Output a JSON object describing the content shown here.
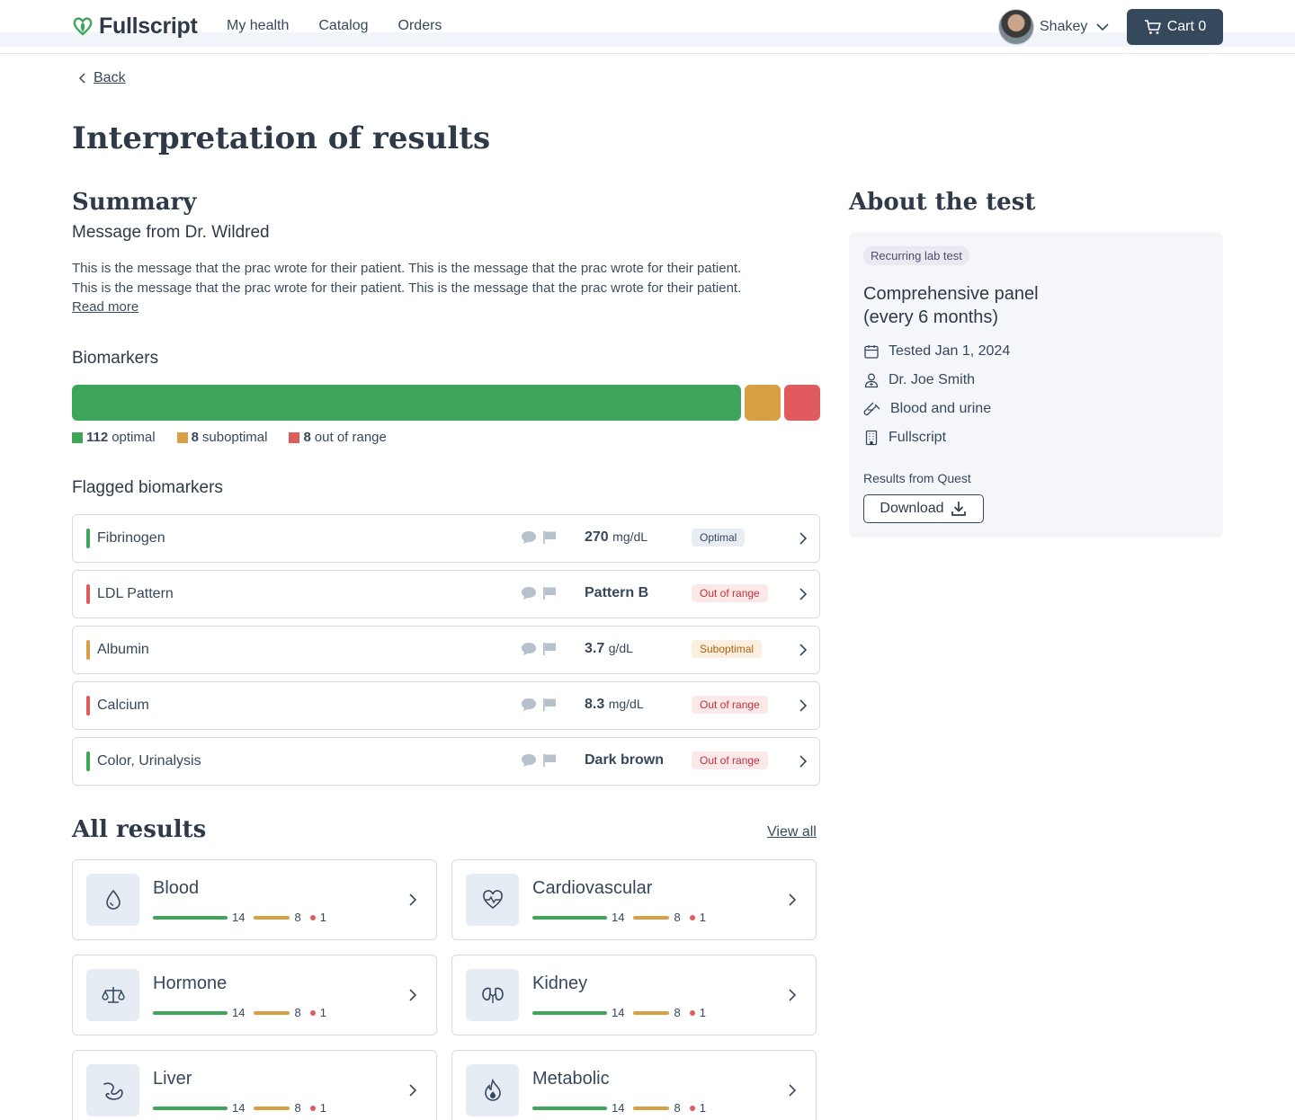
{
  "header": {
    "brand": "Fullscript",
    "nav": [
      "My health",
      "Catalog",
      "Orders"
    ],
    "user_name": "Shakey",
    "cart_label": "Cart 0"
  },
  "back_label": "Back",
  "page_title": "Interpretation of results",
  "summary": {
    "title": "Summary",
    "message_from": "Message from Dr. Wildred",
    "message_line1": "This is the message that the prac wrote for their patient. This is the message that the prac wrote for their patient.",
    "message_line2": "This is the message that the prac wrote for their patient. This is the message that the prac wrote for their patient.",
    "read_more": "Read more"
  },
  "biomarkers": {
    "title": "Biomarkers",
    "optimal_count": "112",
    "optimal_label": "optimal",
    "suboptimal_count": "8",
    "suboptimal_label": "suboptimal",
    "out_count": "8",
    "out_label": "out of range",
    "colors": {
      "optimal": "#3fa55a",
      "suboptimal": "#d9a043",
      "out": "#e05a5e"
    }
  },
  "flagged": {
    "title": "Flagged biomarkers",
    "rows": [
      {
        "name": "Fibrinogen",
        "value": "270",
        "unit": "mg/dL",
        "status": "Optimal",
        "indicator": "#3fa55a"
      },
      {
        "name": "LDL Pattern",
        "value": "Pattern B",
        "unit": "",
        "status": "Out of range",
        "indicator": "#e05a5e"
      },
      {
        "name": "Albumin",
        "value": "3.7",
        "unit": "g/dL",
        "status": "Suboptimal",
        "indicator": "#d9a043"
      },
      {
        "name": "Calcium",
        "value": "8.3",
        "unit": "mg/dL",
        "status": "Out of range",
        "indicator": "#e05a5e"
      },
      {
        "name": "Color, Urinalysis",
        "value": "Dark brown",
        "unit": "",
        "status": "Out of range",
        "indicator": "#3fa55a"
      }
    ]
  },
  "all_results": {
    "title": "All results",
    "view_all": "View all",
    "categories": [
      {
        "name": "Blood",
        "icon": "drop-icon",
        "optimal": "14",
        "suboptimal": "8",
        "out": "1"
      },
      {
        "name": "Cardiovascular",
        "icon": "heart-pulse-icon",
        "optimal": "14",
        "suboptimal": "8",
        "out": "1"
      },
      {
        "name": "Hormone",
        "icon": "scale-icon",
        "optimal": "14",
        "suboptimal": "8",
        "out": "1"
      },
      {
        "name": "Kidney",
        "icon": "kidney-icon",
        "optimal": "14",
        "suboptimal": "8",
        "out": "1"
      },
      {
        "name": "Liver",
        "icon": "liver-icon",
        "optimal": "14",
        "suboptimal": "8",
        "out": "1"
      },
      {
        "name": "Metabolic",
        "icon": "flame-icon",
        "optimal": "14",
        "suboptimal": "8",
        "out": "1"
      }
    ]
  },
  "about": {
    "title": "About the test",
    "tag": "Recurring lab test",
    "test_name_line1": "Comprehensive panel",
    "test_name_line2": "(every 6 months)",
    "tested": "Tested Jan 1, 2024",
    "doctor": "Dr. Joe Smith",
    "sample": "Blood and urine",
    "provider": "Fullscript",
    "results_from": "Results from Quest",
    "download": "Download"
  }
}
